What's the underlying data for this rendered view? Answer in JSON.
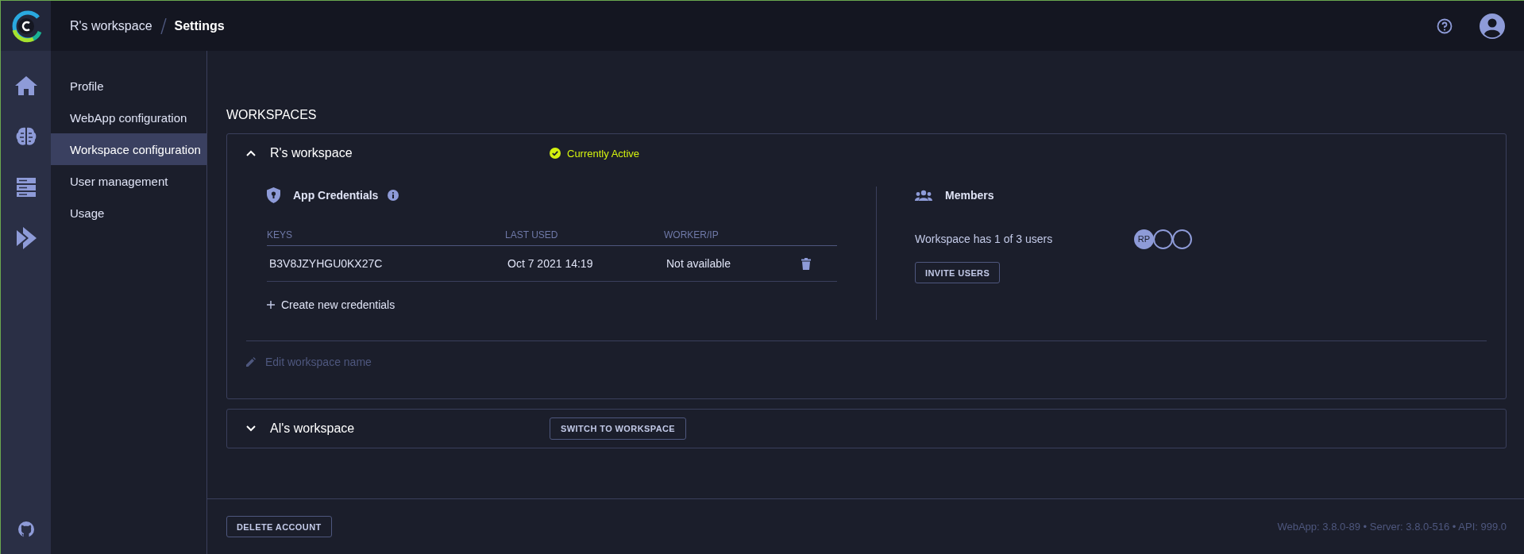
{
  "header": {
    "breadcrumb": [
      "R's workspace",
      "Settings"
    ]
  },
  "rail": [
    {
      "kind": "home",
      "selected": false
    },
    {
      "kind": "brain",
      "selected": false
    },
    {
      "kind": "server",
      "selected": false
    },
    {
      "kind": "deploy",
      "selected": false
    }
  ],
  "sidebar": {
    "items": [
      {
        "label": "Profile",
        "selected": false
      },
      {
        "label": "WebApp configuration",
        "selected": false
      },
      {
        "label": "Workspace configuration",
        "selected": true
      },
      {
        "label": "User management",
        "selected": false
      },
      {
        "label": "Usage",
        "selected": false
      }
    ]
  },
  "section_title": "WORKSPACES",
  "workspaces": [
    {
      "name": "R's workspace",
      "expanded": true,
      "status": "Currently Active",
      "credentials": {
        "title": "App Credentials",
        "columns": [
          "KEYS",
          "LAST USED",
          "WORKER/IP"
        ],
        "rows": [
          {
            "key": "B3V8JZYHGU0KX27C",
            "last_used": "Oct 7 2021 14:19",
            "worker_ip": "Not available"
          }
        ],
        "create": "Create new credentials"
      },
      "members": {
        "title": "Members",
        "summary": "Workspace has 1 of 3 users",
        "avatars": [
          {
            "kind": "filled",
            "initials": "RP"
          },
          {
            "kind": "empty"
          },
          {
            "kind": "empty"
          }
        ],
        "invite": "INVITE USERS"
      },
      "edit_name": "Edit workspace name"
    },
    {
      "name": "Al's workspace",
      "expanded": false,
      "action": "SWITCH TO WORKSPACE"
    }
  ],
  "footer": {
    "delete": "DELETE ACCOUNT",
    "version": "WebApp: 3.8.0-89 • Server: 3.8.0-516 • API: 999.0"
  }
}
